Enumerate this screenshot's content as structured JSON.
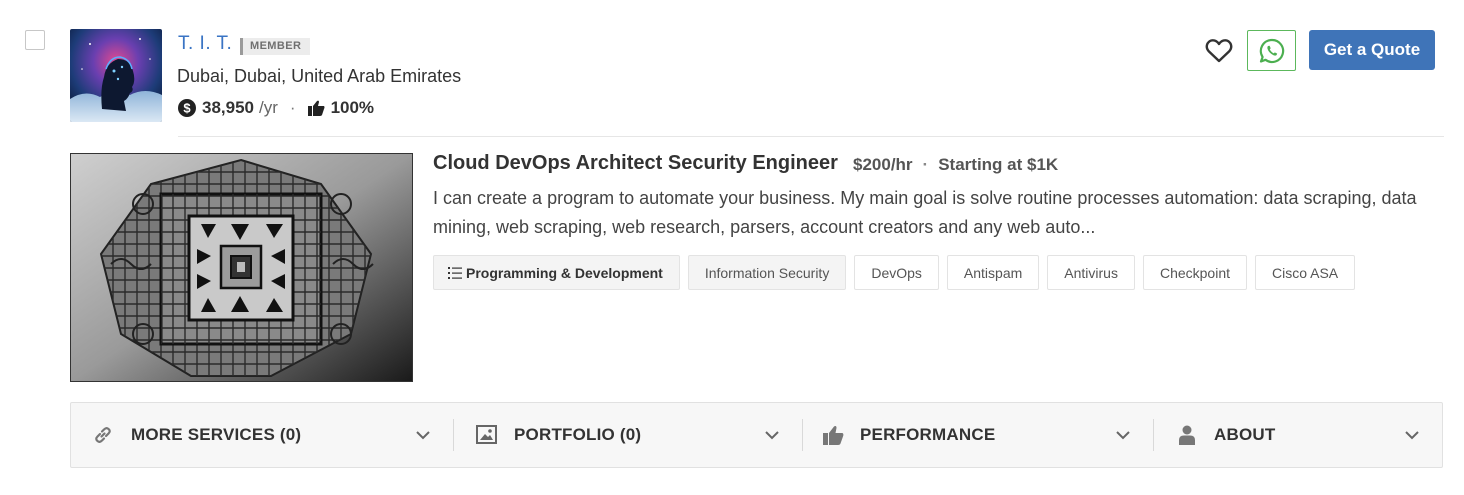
{
  "profile": {
    "name": "T. I. T.",
    "badge": "MEMBER",
    "location": "Dubai, Dubai, United Arab Emirates",
    "earnings": "38,950",
    "earnings_unit": "/yr",
    "separator": "·",
    "rating": "100%"
  },
  "actions": {
    "quote_label": "Get a Quote"
  },
  "service": {
    "title": "Cloud DevOps Architect Security Engineer",
    "rate": "$200/hr",
    "rate_sep": "·",
    "starting": "Starting at $1K",
    "description": "I can create a program to automate your business. My main goal is solve routine processes automation: data scraping, data mining, web scraping, web research, parsers, account creators and any web auto...",
    "category": "Programming & Development",
    "tags": [
      "Information Security",
      "DevOps",
      "Antispam",
      "Antivirus",
      "Checkpoint",
      "Cisco ASA"
    ]
  },
  "tabs": [
    {
      "label": "MORE SERVICES (0)",
      "icon": "link-icon"
    },
    {
      "label": "PORTFOLIO (0)",
      "icon": "image-icon"
    },
    {
      "label": "PERFORMANCE",
      "icon": "thumbs-up-icon"
    },
    {
      "label": "ABOUT",
      "icon": "user-icon"
    }
  ],
  "colors": {
    "link_blue": "#3a74c4",
    "button_blue": "#3f74b8",
    "whatsapp_green": "#5cb85c"
  }
}
